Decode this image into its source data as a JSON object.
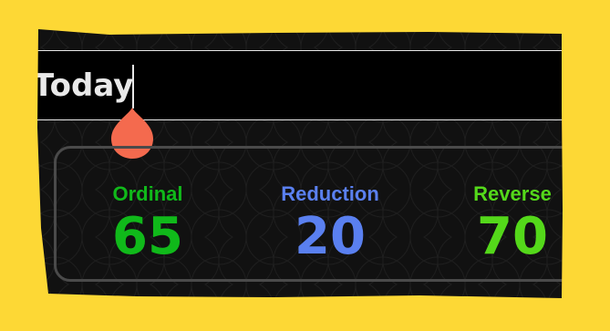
{
  "title": {
    "value": "Today"
  },
  "stats": [
    {
      "label": "Ordinal",
      "value": "65",
      "color": "#10b91a"
    },
    {
      "label": "Reduction",
      "value": "20",
      "color": "#5a80f0"
    },
    {
      "label": "Reverse",
      "value": "70",
      "color": "#54d81a"
    }
  ],
  "colors": {
    "frame": "#fdd835",
    "handle": "#f46a4e",
    "card_border": "#4a4a4a",
    "background": "#111111"
  },
  "icons": {
    "drag_handle": "teardrop-handle-icon"
  }
}
